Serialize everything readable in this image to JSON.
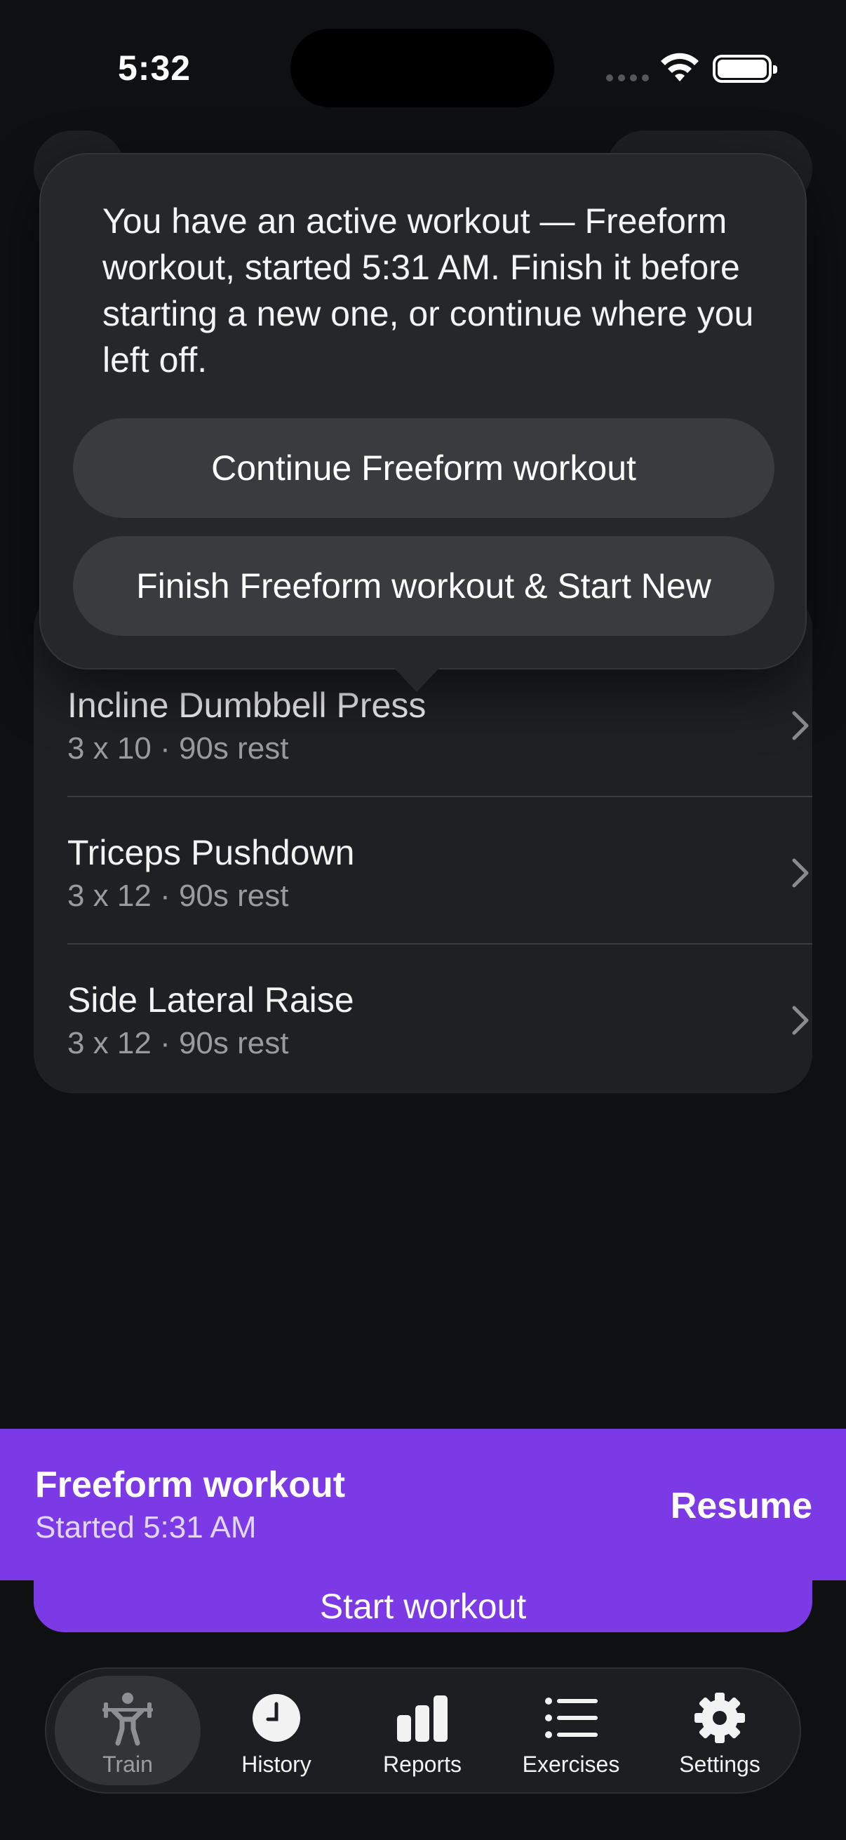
{
  "status_bar": {
    "time": "5:32"
  },
  "exercises": [
    {
      "name": "Incline Dumbbell Press",
      "detail": "3 x 10 · 90s rest"
    },
    {
      "name": "Triceps Pushdown",
      "detail": "3 x 12 · 90s rest"
    },
    {
      "name": "Side Lateral Raise",
      "detail": "3 x 12 · 90s rest"
    }
  ],
  "popover": {
    "message": "You have an active workout — Freeform workout, started 5:31 AM. Finish it before starting a new one, or continue where you left off.",
    "continue_label": "Continue Freeform workout",
    "finish_label": "Finish Freeform workout & Start New"
  },
  "active_banner": {
    "title": "Freeform workout",
    "subtitle": "Started 5:31 AM",
    "resume_label": "Resume"
  },
  "start_workout_label": "Start workout",
  "tabs": [
    {
      "label": "Train",
      "icon": "weightlifter-icon",
      "active": true
    },
    {
      "label": "History",
      "icon": "clock-icon",
      "active": false
    },
    {
      "label": "Reports",
      "icon": "bar-chart-icon",
      "active": false
    },
    {
      "label": "Exercises",
      "icon": "list-icon",
      "active": false
    },
    {
      "label": "Settings",
      "icon": "gear-icon",
      "active": false
    }
  ],
  "colors": {
    "accent": "#7b3ae6",
    "background": "#0f1012",
    "card": "#1f2023"
  }
}
